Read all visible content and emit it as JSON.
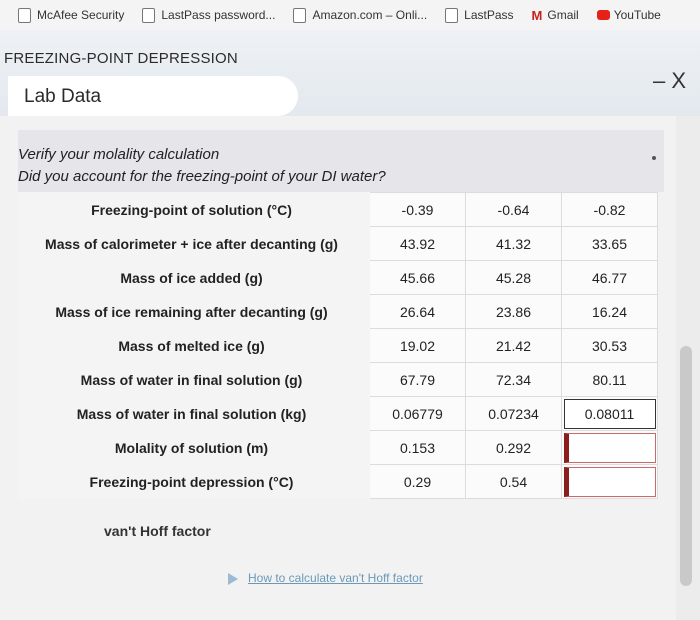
{
  "bookmarks": [
    {
      "label": "McAfee Security"
    },
    {
      "label": "LastPass password..."
    },
    {
      "label": "Amazon.com – Onli..."
    },
    {
      "label": "LastPass"
    },
    {
      "label": "Gmail"
    },
    {
      "label": "YouTube"
    }
  ],
  "app": {
    "title": "FREEZING-POINT DEPRESSION",
    "close_label": "– X"
  },
  "panel": {
    "title": "Lab Data"
  },
  "prompt": {
    "line1": "Verify your molality calculation",
    "line2": "Did you account for the freezing-point of your DI water?"
  },
  "table": {
    "rows": [
      {
        "label": "Freezing-point of solution (°C)",
        "values": [
          "-0.39",
          "-0.64",
          "-0.82"
        ]
      },
      {
        "label": "Mass of calorimeter + ice after decanting (g)",
        "values": [
          "43.92",
          "41.32",
          "33.65"
        ]
      },
      {
        "label": "Mass of ice added (g)",
        "values": [
          "45.66",
          "45.28",
          "46.77"
        ]
      },
      {
        "label": "Mass of ice remaining after decanting (g)",
        "values": [
          "26.64",
          "23.86",
          "16.24"
        ]
      },
      {
        "label": "Mass of melted ice (g)",
        "values": [
          "19.02",
          "21.42",
          "30.53"
        ]
      },
      {
        "label": "Mass of water in final solution (g)",
        "values": [
          "67.79",
          "72.34",
          "80.11"
        ]
      },
      {
        "label": "Mass of water in final solution (kg)",
        "values": [
          "0.06779",
          "0.07234",
          "0.08011"
        ]
      },
      {
        "label": "Molality of solution (m)",
        "values": [
          "0.153",
          "0.292",
          ""
        ]
      },
      {
        "label": "Freezing-point depression (°C)",
        "values": [
          "0.29",
          "0.54",
          ""
        ]
      }
    ]
  },
  "vant_hoff": {
    "label": "van't Hoff factor"
  },
  "help_link": {
    "label": "How to calculate van't Hoff factor"
  }
}
